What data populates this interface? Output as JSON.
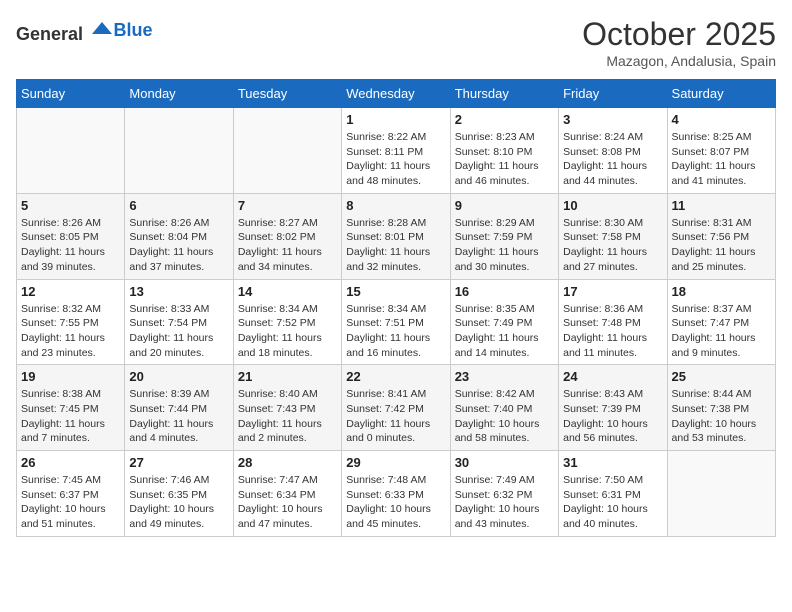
{
  "header": {
    "logo_general": "General",
    "logo_blue": "Blue",
    "month_title": "October 2025",
    "subtitle": "Mazagon, Andalusia, Spain"
  },
  "weekdays": [
    "Sunday",
    "Monday",
    "Tuesday",
    "Wednesday",
    "Thursday",
    "Friday",
    "Saturday"
  ],
  "weeks": [
    [
      {
        "day": "",
        "sunrise": "",
        "sunset": "",
        "daylight": ""
      },
      {
        "day": "",
        "sunrise": "",
        "sunset": "",
        "daylight": ""
      },
      {
        "day": "",
        "sunrise": "",
        "sunset": "",
        "daylight": ""
      },
      {
        "day": "1",
        "sunrise": "8:22 AM",
        "sunset": "8:11 PM",
        "daylight": "11 hours and 48 minutes."
      },
      {
        "day": "2",
        "sunrise": "8:23 AM",
        "sunset": "8:10 PM",
        "daylight": "11 hours and 46 minutes."
      },
      {
        "day": "3",
        "sunrise": "8:24 AM",
        "sunset": "8:08 PM",
        "daylight": "11 hours and 44 minutes."
      },
      {
        "day": "4",
        "sunrise": "8:25 AM",
        "sunset": "8:07 PM",
        "daylight": "11 hours and 41 minutes."
      }
    ],
    [
      {
        "day": "5",
        "sunrise": "8:26 AM",
        "sunset": "8:05 PM",
        "daylight": "11 hours and 39 minutes."
      },
      {
        "day": "6",
        "sunrise": "8:26 AM",
        "sunset": "8:04 PM",
        "daylight": "11 hours and 37 minutes."
      },
      {
        "day": "7",
        "sunrise": "8:27 AM",
        "sunset": "8:02 PM",
        "daylight": "11 hours and 34 minutes."
      },
      {
        "day": "8",
        "sunrise": "8:28 AM",
        "sunset": "8:01 PM",
        "daylight": "11 hours and 32 minutes."
      },
      {
        "day": "9",
        "sunrise": "8:29 AM",
        "sunset": "7:59 PM",
        "daylight": "11 hours and 30 minutes."
      },
      {
        "day": "10",
        "sunrise": "8:30 AM",
        "sunset": "7:58 PM",
        "daylight": "11 hours and 27 minutes."
      },
      {
        "day": "11",
        "sunrise": "8:31 AM",
        "sunset": "7:56 PM",
        "daylight": "11 hours and 25 minutes."
      }
    ],
    [
      {
        "day": "12",
        "sunrise": "8:32 AM",
        "sunset": "7:55 PM",
        "daylight": "11 hours and 23 minutes."
      },
      {
        "day": "13",
        "sunrise": "8:33 AM",
        "sunset": "7:54 PM",
        "daylight": "11 hours and 20 minutes."
      },
      {
        "day": "14",
        "sunrise": "8:34 AM",
        "sunset": "7:52 PM",
        "daylight": "11 hours and 18 minutes."
      },
      {
        "day": "15",
        "sunrise": "8:34 AM",
        "sunset": "7:51 PM",
        "daylight": "11 hours and 16 minutes."
      },
      {
        "day": "16",
        "sunrise": "8:35 AM",
        "sunset": "7:49 PM",
        "daylight": "11 hours and 14 minutes."
      },
      {
        "day": "17",
        "sunrise": "8:36 AM",
        "sunset": "7:48 PM",
        "daylight": "11 hours and 11 minutes."
      },
      {
        "day": "18",
        "sunrise": "8:37 AM",
        "sunset": "7:47 PM",
        "daylight": "11 hours and 9 minutes."
      }
    ],
    [
      {
        "day": "19",
        "sunrise": "8:38 AM",
        "sunset": "7:45 PM",
        "daylight": "11 hours and 7 minutes."
      },
      {
        "day": "20",
        "sunrise": "8:39 AM",
        "sunset": "7:44 PM",
        "daylight": "11 hours and 4 minutes."
      },
      {
        "day": "21",
        "sunrise": "8:40 AM",
        "sunset": "7:43 PM",
        "daylight": "11 hours and 2 minutes."
      },
      {
        "day": "22",
        "sunrise": "8:41 AM",
        "sunset": "7:42 PM",
        "daylight": "11 hours and 0 minutes."
      },
      {
        "day": "23",
        "sunrise": "8:42 AM",
        "sunset": "7:40 PM",
        "daylight": "10 hours and 58 minutes."
      },
      {
        "day": "24",
        "sunrise": "8:43 AM",
        "sunset": "7:39 PM",
        "daylight": "10 hours and 56 minutes."
      },
      {
        "day": "25",
        "sunrise": "8:44 AM",
        "sunset": "7:38 PM",
        "daylight": "10 hours and 53 minutes."
      }
    ],
    [
      {
        "day": "26",
        "sunrise": "7:45 AM",
        "sunset": "6:37 PM",
        "daylight": "10 hours and 51 minutes."
      },
      {
        "day": "27",
        "sunrise": "7:46 AM",
        "sunset": "6:35 PM",
        "daylight": "10 hours and 49 minutes."
      },
      {
        "day": "28",
        "sunrise": "7:47 AM",
        "sunset": "6:34 PM",
        "daylight": "10 hours and 47 minutes."
      },
      {
        "day": "29",
        "sunrise": "7:48 AM",
        "sunset": "6:33 PM",
        "daylight": "10 hours and 45 minutes."
      },
      {
        "day": "30",
        "sunrise": "7:49 AM",
        "sunset": "6:32 PM",
        "daylight": "10 hours and 43 minutes."
      },
      {
        "day": "31",
        "sunrise": "7:50 AM",
        "sunset": "6:31 PM",
        "daylight": "10 hours and 40 minutes."
      },
      {
        "day": "",
        "sunrise": "",
        "sunset": "",
        "daylight": ""
      }
    ]
  ]
}
